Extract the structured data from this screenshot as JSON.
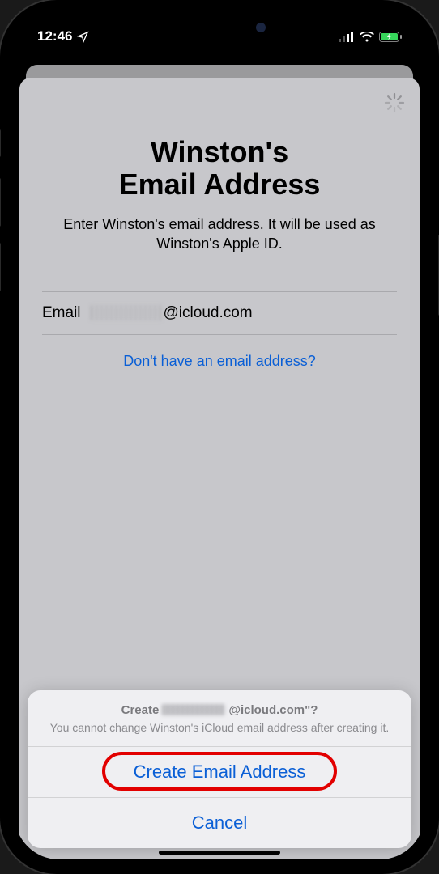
{
  "status": {
    "time": "12:46"
  },
  "sheet": {
    "title": "Winston's\nEmail Address",
    "subtitle": "Enter Winston's email address. It will be used as Winston's Apple ID.",
    "field_label": "Email",
    "field_domain": "@icloud.com",
    "link": "Don't have an email address?"
  },
  "action_sheet": {
    "title_prefix": "Create",
    "title_suffix": "@icloud.com\"?",
    "subtitle": "You cannot change Winston's iCloud email address after creating it.",
    "primary": "Create Email Address",
    "cancel": "Cancel"
  }
}
